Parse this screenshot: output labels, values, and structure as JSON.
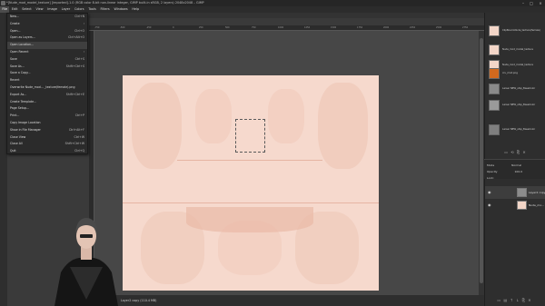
{
  "window": {
    "title": "*[Nude_mod_model_texture] [imported]-1.0 (RGB color 8-bit non-linear integer, GIMP built-in sRGB, 2 layers) 2048x2048 – GIMP",
    "controls": [
      "–",
      "□",
      "×"
    ]
  },
  "menubar": [
    "File",
    "Edit",
    "Select",
    "View",
    "Image",
    "Layer",
    "Colors",
    "Tools",
    "Filters",
    "Windows",
    "Help"
  ],
  "file_menu": [
    {
      "label": "New...",
      "shortcut": "Ctrl+N"
    },
    {
      "label": "Create",
      "shortcut": "›"
    },
    {
      "label": "Open...",
      "shortcut": "Ctrl+O"
    },
    {
      "label": "Open as Layers...",
      "shortcut": "Ctrl+Alt+O"
    },
    {
      "label": "Open Location...",
      "shortcut": ""
    },
    {
      "label": "Open Recent",
      "shortcut": "›"
    },
    {
      "label": "Save",
      "shortcut": "Ctrl+S"
    },
    {
      "label": "Save As...",
      "shortcut": "Shift+Ctrl+S"
    },
    {
      "label": "Save a Copy...",
      "shortcut": ""
    },
    {
      "label": "Revert",
      "shortcut": ""
    },
    {
      "label": "Overwrite Nude_mod... _texture(female).png",
      "shortcut": ""
    },
    {
      "label": "Export As...",
      "shortcut": "Shift+Ctrl+E"
    },
    {
      "label": "Create Template...",
      "shortcut": ""
    },
    {
      "label": "Page Setup...",
      "shortcut": ""
    },
    {
      "label": "Print...",
      "shortcut": "Ctrl+P"
    },
    {
      "label": "Copy Image Location",
      "shortcut": ""
    },
    {
      "label": "Show in File Manager",
      "shortcut": "Ctrl+Alt+F"
    },
    {
      "label": "Close View",
      "shortcut": "Ctrl+W"
    },
    {
      "label": "Close All",
      "shortcut": "Shift+Ctrl+W"
    },
    {
      "label": "Quit",
      "shortcut": "Ctrl+Q"
    }
  ],
  "ruler": {
    "ticks": [
      "-750",
      "-500",
      "-250",
      "0",
      "250",
      "500",
      "750",
      "1000",
      "1250",
      "1500",
      "1750",
      "2000",
      "2250",
      "2500",
      "2750"
    ]
  },
  "status": {
    "text": "Layer2 copy (110.4 MB)"
  },
  "images_panel": [
    {
      "label": "ClipBoard-Nude_texture(female)"
    },
    {
      "label": "Nude_mod_model_texture"
    },
    {
      "label": "Nude_mod_model_texture"
    },
    {
      "label": "cru_mod.png"
    },
    {
      "label": "Larser NEW_ship_BaseColor"
    },
    {
      "label": "Larser NEW_ship_BaseColor"
    },
    {
      "label": "Larser NEW_ship_BaseColor"
    }
  ],
  "layers_panel": {
    "mode_label": "Mode",
    "mode_value": "Normal",
    "opacity_label": "Opacity",
    "opacity_value": "100.0",
    "lock_label": "Lock:",
    "layers": [
      {
        "name": "Layer2 copy"
      },
      {
        "name": "Nude_mo..."
      }
    ]
  },
  "colors": {
    "texture_base": "#f6d9cd",
    "texture_shade": "#efc8b8",
    "ui_dark": "#2e2e2e",
    "canvas_bg": "#474747"
  }
}
